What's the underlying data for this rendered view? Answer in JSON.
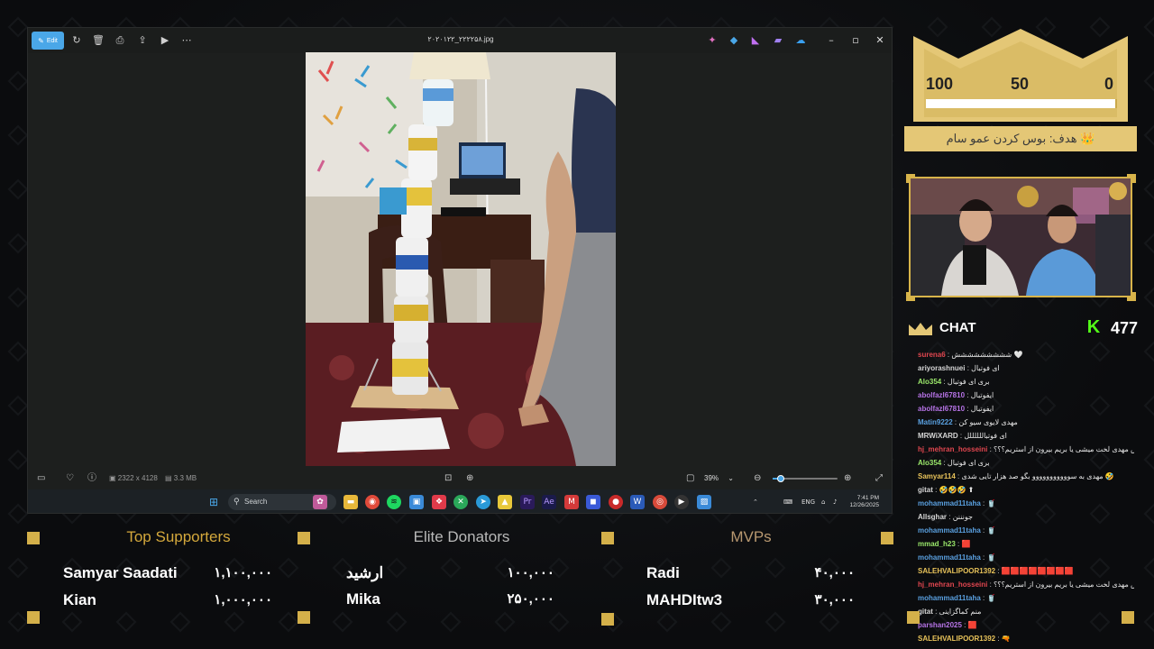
{
  "viewer": {
    "edit_label": "Edit",
    "filename": "۲۰۲۰۱۲۲_۲۲۲۲۵۸.jpg",
    "image_dims": "2322 x 4128",
    "file_size": "3.3 MB",
    "zoom": "39%",
    "zoom_level": 0.12
  },
  "taskbar": {
    "search_placeholder": "Search",
    "lang": "ENG",
    "time": "7:41 PM",
    "date": "12/26/2025"
  },
  "goal": {
    "scale_high": "100",
    "scale_mid": "50",
    "scale_low": "0",
    "progress": 0.01,
    "label": "هدف: بوس کردن عمو سام 👑"
  },
  "chat": {
    "title": "CHAT",
    "viewer_count": "477",
    "messages": [
      {
        "user": "surena6",
        "color": "#e0464f",
        "text": "ششششششششش 🤍"
      },
      {
        "user": "ariyorashnuei",
        "color": "#d6d6d6",
        "text": "ای فوتبال"
      },
      {
        "user": "Alo354",
        "color": "#9be86b",
        "text": "بری ای فوتبال"
      },
      {
        "user": "abolfazl67810",
        "color": "#b673e6",
        "text": "ایفوتبال"
      },
      {
        "user": "abolfazl67810",
        "color": "#b673e6",
        "text": "ایفوتبال"
      },
      {
        "user": "Matin9222",
        "color": "#5aa0e0",
        "text": "مهدی لایوی سیو کن"
      },
      {
        "user": "MRWiXARD",
        "color": "#d6d6d6",
        "text": "ای فوتباللللللل"
      },
      {
        "user": "hj_mehran_hosseini",
        "color": "#e0464f",
        "text": "داش مهدی لخت میشی یا بریم بیرون از استریم؟؟؟"
      },
      {
        "user": "Alo354",
        "color": "#9be86b",
        "text": "بری ای فوتبال"
      },
      {
        "user": "Samyar114",
        "color": "#e8c35a",
        "text": "مهدی به سووووووووووو بگو صد هزار تایی شدی 🤣"
      },
      {
        "user": "gitat",
        "color": "#d6d6d6",
        "text": "🤣🤣🤣 ⬆"
      },
      {
        "user": "mohammad11taha",
        "color": "#5aa0e0",
        "text": "🥤"
      },
      {
        "user": "Allsghar",
        "color": "#d6d6d6",
        "text": "جونننن"
      },
      {
        "user": "mohammad11taha",
        "color": "#5aa0e0",
        "text": "🥤"
      },
      {
        "user": "mmad_h23",
        "color": "#9be86b",
        "text": "🟥"
      },
      {
        "user": "mohammad11taha",
        "color": "#5aa0e0",
        "text": "🥤"
      },
      {
        "user": "SALEHVALIPOOR1392",
        "color": "#e8c35a",
        "text": "🟥🟥🟥🟥🟥🟥🟥🟥"
      },
      {
        "user": "hj_mehran_hosseini",
        "color": "#e0464f",
        "text": "داش مهدی لخت میشی یا بریم بیرون از استریم؟؟؟"
      },
      {
        "user": "mohammad11taha",
        "color": "#5aa0e0",
        "text": "🥤"
      },
      {
        "user": "gitat",
        "color": "#d6d6d6",
        "text": "منم کماگزاینی"
      },
      {
        "user": "parshan2025",
        "color": "#b673e6",
        "text": "🟥"
      },
      {
        "user": "SALEHVALIPOOR1392",
        "color": "#e8c35a",
        "text": "🔫"
      }
    ]
  },
  "panels": {
    "supporters": {
      "title": "Top Supporters",
      "rows": [
        {
          "name": "Samyar Saadati",
          "amount": "۱,۱۰۰,۰۰۰"
        },
        {
          "name": "Kian",
          "amount": "۱,۰۰۰,۰۰۰"
        }
      ]
    },
    "donators": {
      "title": "Elite Donators",
      "rows": [
        {
          "name": "ارشید",
          "amount": "۱۰۰,۰۰۰"
        },
        {
          "name": "Mika",
          "amount": "۲۵۰,۰۰۰"
        }
      ]
    },
    "mvps": {
      "title": "MVPs",
      "rows": [
        {
          "name": "Radi",
          "amount": "۴۰,۰۰۰"
        },
        {
          "name": "MAHDItw3",
          "amount": "۳۰,۰۰۰"
        }
      ]
    }
  }
}
